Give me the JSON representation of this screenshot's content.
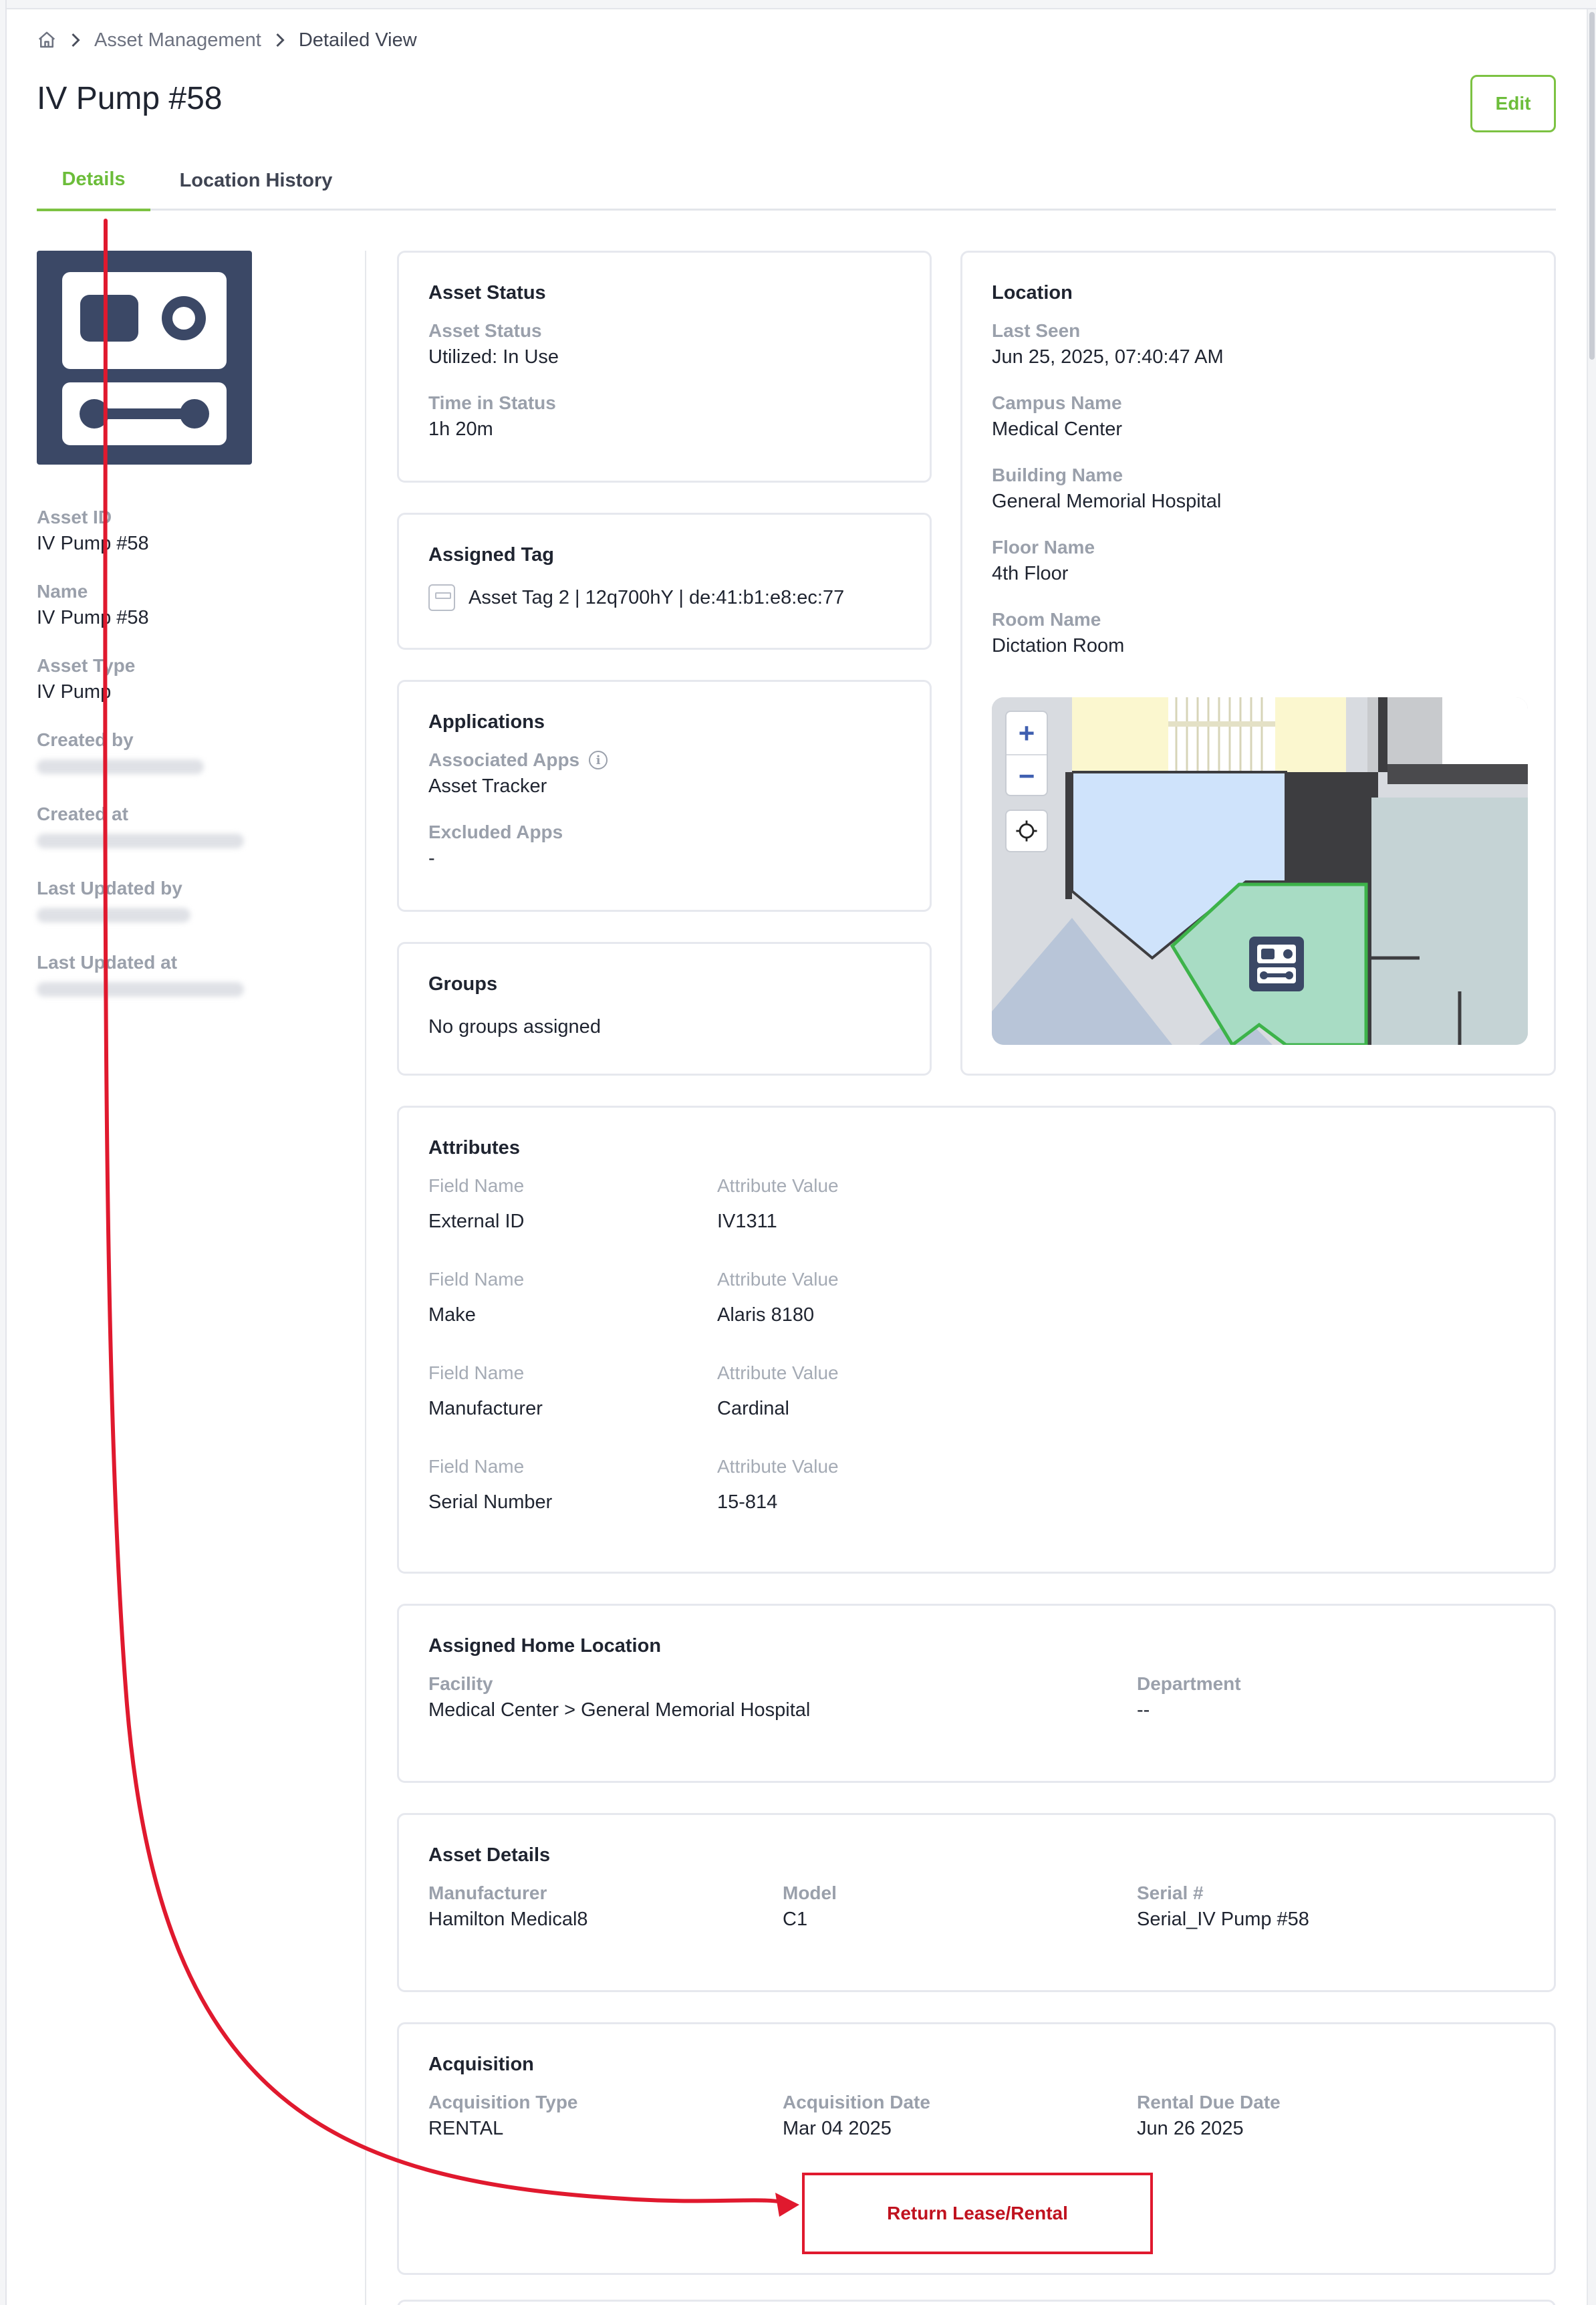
{
  "breadcrumb": {
    "section": "Asset Management",
    "current": "Detailed View"
  },
  "page": {
    "title": "IV Pump #58",
    "edit_label": "Edit"
  },
  "tabs": [
    {
      "label": "Details",
      "active": true
    },
    {
      "label": "Location History",
      "active": false
    }
  ],
  "sidebar": {
    "fields": [
      {
        "label": "Asset ID",
        "value": "IV Pump #58"
      },
      {
        "label": "Name",
        "value": "IV Pump #58"
      },
      {
        "label": "Asset Type",
        "value": "IV Pump"
      },
      {
        "label": "Created by",
        "value": "",
        "redacted": true
      },
      {
        "label": "Created at",
        "value": "",
        "redacted": true
      },
      {
        "label": "Last Updated by",
        "value": "",
        "redacted": true
      },
      {
        "label": "Last Updated at",
        "value": "",
        "redacted": true
      }
    ]
  },
  "asset_status": {
    "title": "Asset Status",
    "status_label": "Asset Status",
    "status_value": "Utilized: In Use",
    "time_label": "Time in Status",
    "time_value": "1h 20m"
  },
  "assigned_tag": {
    "title": "Assigned Tag",
    "tag_text": "Asset Tag 2 | 12q700hY | de:41:b1:e8:ec:77"
  },
  "applications": {
    "title": "Applications",
    "associated_label": "Associated Apps",
    "associated_value": "Asset Tracker",
    "excluded_label": "Excluded Apps",
    "excluded_value": "-"
  },
  "groups": {
    "title": "Groups",
    "value": "No groups assigned"
  },
  "location": {
    "title": "Location",
    "fields": [
      {
        "label": "Last Seen",
        "value": "Jun 25, 2025, 07:40:47 AM"
      },
      {
        "label": "Campus Name",
        "value": "Medical Center"
      },
      {
        "label": "Building Name",
        "value": "General Memorial Hospital"
      },
      {
        "label": "Floor Name",
        "value": "4th Floor"
      },
      {
        "label": "Room Name",
        "value": "Dictation Room"
      }
    ],
    "map": {
      "zoom_in": "+",
      "zoom_out": "−"
    }
  },
  "attributes": {
    "title": "Attributes",
    "field_header": "Field Name",
    "value_header": "Attribute Value",
    "rows": [
      {
        "field": "External ID",
        "value": "IV1311"
      },
      {
        "field": "Make",
        "value": "Alaris 8180"
      },
      {
        "field": "Manufacturer",
        "value": "Cardinal"
      },
      {
        "field": "Serial Number",
        "value": "15-814"
      }
    ]
  },
  "home_location": {
    "title": "Assigned Home Location",
    "facility_label": "Facility",
    "facility_value": "Medical Center > General Memorial Hospital",
    "department_label": "Department",
    "department_value": "--"
  },
  "asset_details": {
    "title": "Asset Details",
    "manufacturer_label": "Manufacturer",
    "manufacturer_value": "Hamilton Medical8",
    "model_label": "Model",
    "model_value": "C1",
    "serial_label": "Serial #",
    "serial_value": "Serial_IV Pump #58"
  },
  "acquisition": {
    "title": "Acquisition",
    "type_label": "Acquisition Type",
    "type_value": "RENTAL",
    "date_label": "Acquisition Date",
    "date_value": "Mar 04 2025",
    "due_label": "Rental Due Date",
    "due_value": "Jun 26 2025",
    "return_label": "Return Lease/Rental"
  },
  "colors": {
    "accent_green": "#7cc242",
    "asset_icon_bg": "#3b4866",
    "annotation_red": "#e0192e",
    "room_highlight": "#a8dcc4"
  }
}
